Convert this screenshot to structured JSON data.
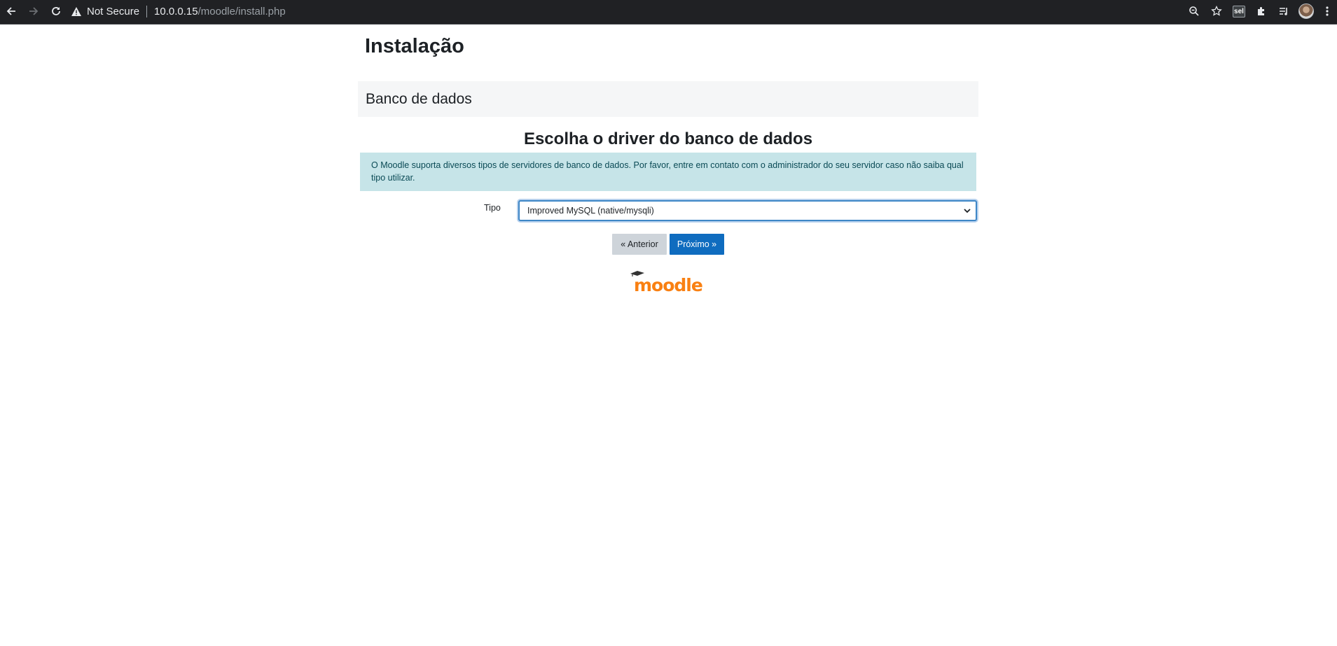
{
  "browser": {
    "security_label": "Not Secure",
    "url_host": "10.0.0.15",
    "url_path": "/moodle/install.php",
    "extension_label": "sel"
  },
  "page": {
    "title": "Instalação",
    "section_title": "Banco de dados",
    "step_heading": "Escolha o driver do banco de dados",
    "info_text": "O Moodle suporta diversos tipos de servidores de banco de dados. Por favor, entre em contato com o administrador do seu servidor caso não saiba qual tipo utilizar.",
    "field_label": "Tipo",
    "selected_driver": "Improved MySQL (native/mysqli)",
    "prev_button": "« Anterior",
    "next_button": "Próximo »",
    "logo_text": "moodle"
  },
  "colors": {
    "primary_button": "#0f6cbf",
    "secondary_button": "#ced4da",
    "info_background": "#c6e4e8",
    "logo": "#f98012"
  }
}
